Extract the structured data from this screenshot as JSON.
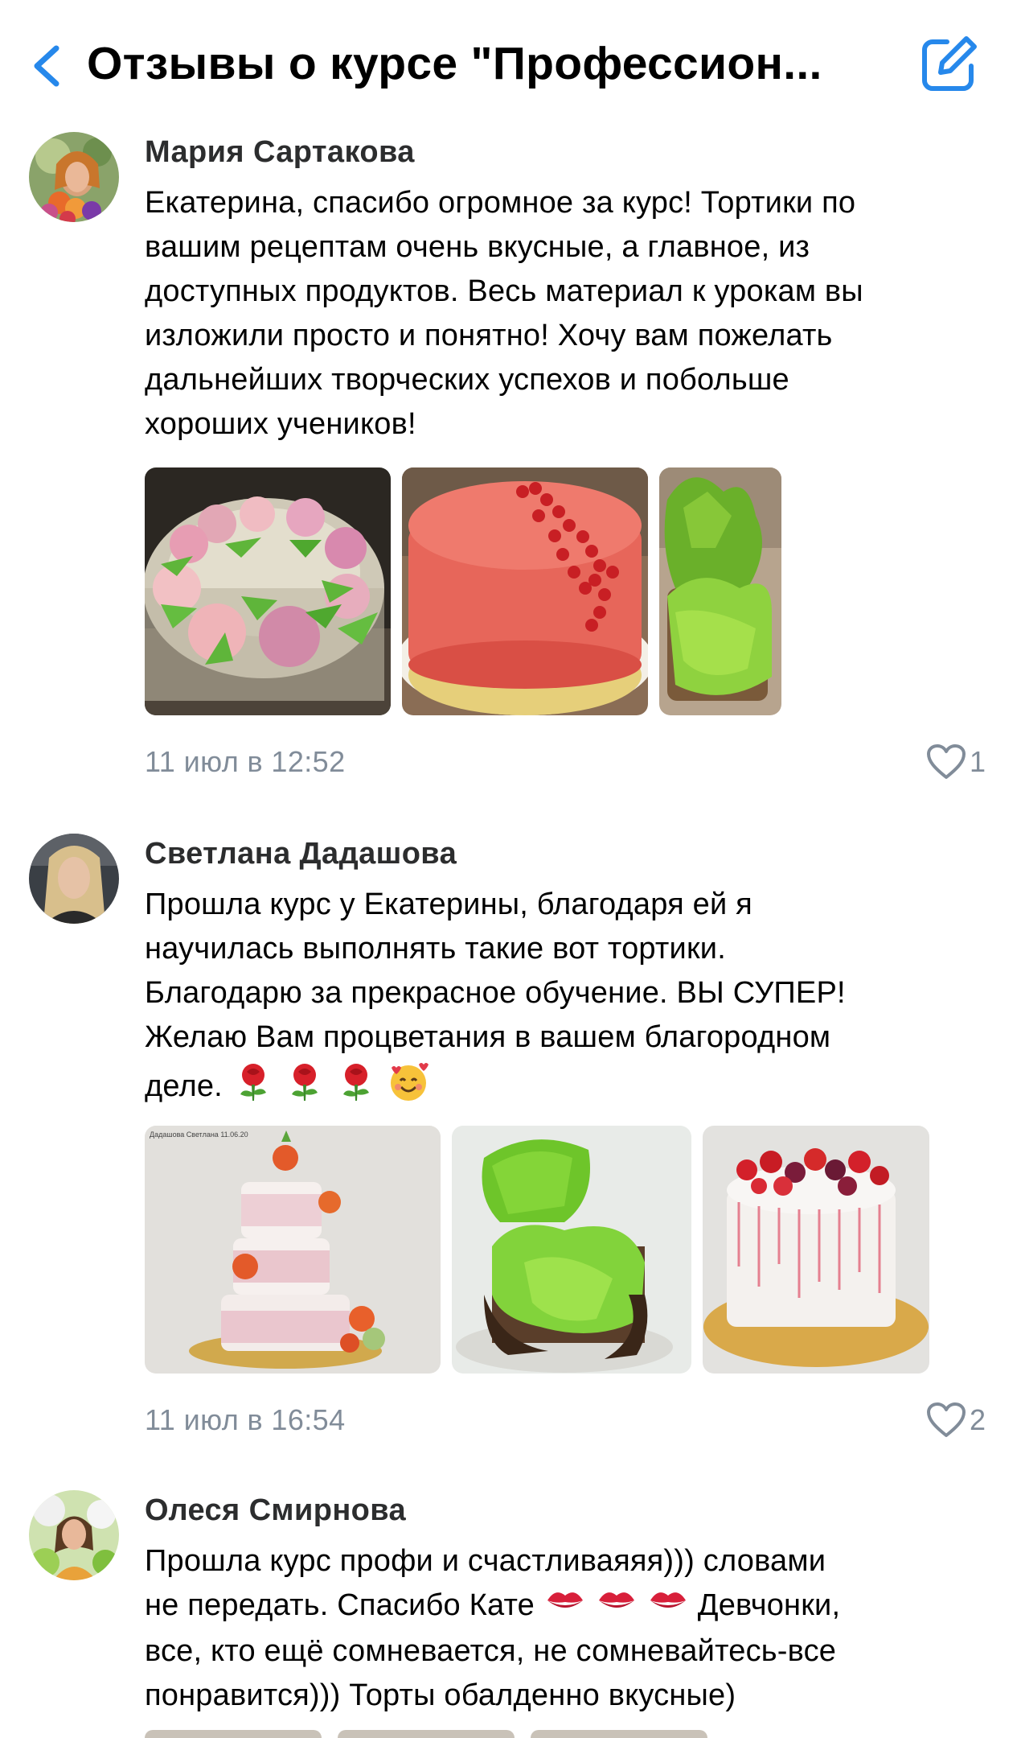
{
  "header": {
    "title": "Отзывы о курсе \"Профессион...",
    "back_icon": "chevron-left-icon",
    "edit_icon": "compose-icon",
    "accent_color": "#2688eb"
  },
  "comments": [
    {
      "author": "Мария Сартакова",
      "lines": [
        "Екатерина, спасибо огромное за курс! Тортики по",
        "вашим рецептам очень вкусные, а главное, из",
        "доступных продуктов. Весь материал к урокам вы",
        "изложили просто и понятно! Хочу вам пожелать",
        "дальнейших творческих успехов и побольше",
        "хороших учеников!"
      ],
      "time": "11 июл в 12:52",
      "likes": "1"
    },
    {
      "author": "Светлана Дадашова",
      "lines": [
        "Прошла курс у Екатерины, благодаря ей я",
        "научилась выполнять такие вот тортики.",
        "Благодарю за прекрасное обучение. ВЫ СУПЕР!",
        "Желаю Вам процветания в вашем благородном",
        "деле."
      ],
      "emoji": [
        "rose-emoji",
        "rose-emoji",
        "rose-emoji",
        "smiling-face-with-hearts-emoji"
      ],
      "photo_caption": "Дадашова Светлана 11.06.20",
      "time": "11 июл в 16:54",
      "likes": "2"
    },
    {
      "author": "Олеся Смирнова",
      "lines": [
        "Прошла курс профи и счастливаяяя))) словами",
        "не передать. Спасибо Кате",
        "Девчонки,",
        "все, кто ещё сомневается, не сомневайтесь-все",
        "понравится))) Торты обалденно вкусные)"
      ],
      "emoji": [
        "kiss-mark-emoji",
        "kiss-mark-emoji",
        "kiss-mark-emoji"
      ]
    }
  ],
  "colors": {
    "meta": "#818c99",
    "author": "#2c2d2e"
  }
}
